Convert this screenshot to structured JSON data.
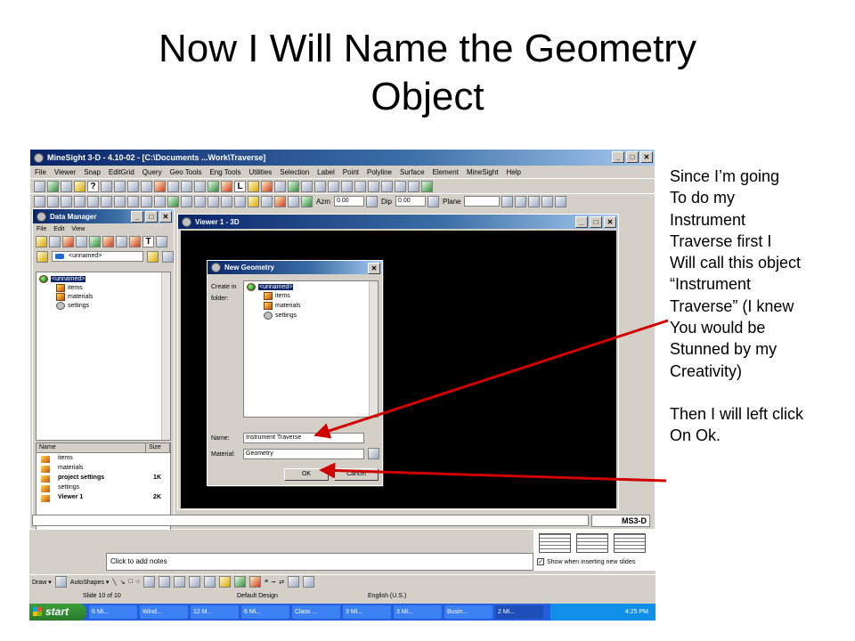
{
  "slide": {
    "title_line1": "Now I Will Name the Geometry",
    "title_line2": "Object",
    "notes": [
      "Since I’m going",
      "To do my",
      "Instrument",
      "Traverse first I",
      "Will call this object",
      "“Instrument",
      "Traverse” (I knew",
      "You would be",
      "Stunned by my",
      "Creativity)",
      "",
      "Then I will left click",
      "On Ok."
    ]
  },
  "minesight": {
    "title": "MineSight 3-D  - 4.10-02 - [C:\\Documents ...Work\\Traverse]",
    "menu": [
      "File",
      "Viewer",
      "Snap",
      "EditGrid",
      "Query",
      "Geo Tools",
      "Eng Tools",
      "Utilities",
      "Selection",
      "Label",
      "Point",
      "Polyline",
      "Surface",
      "Element",
      "MineSight",
      "Help"
    ],
    "azm_label": "Azm",
    "azm_value": "0.00",
    "dip_label": "Dip",
    "dip_value": "0.00",
    "plane_label": "Plane"
  },
  "data_manager": {
    "title": "Data Manager",
    "menu": [
      "File",
      "Edit",
      "View"
    ],
    "combo_value": "<unnamed>",
    "tree": [
      "<unnamed>",
      "items",
      "materials",
      "settings"
    ],
    "list_headers": [
      "Name",
      "Size"
    ],
    "list_rows": [
      {
        "name": "items",
        "size": ""
      },
      {
        "name": "materials",
        "size": ""
      },
      {
        "name": "project settings",
        "size": "1K"
      },
      {
        "name": "settings",
        "size": ""
      },
      {
        "name": "Viewer 1",
        "size": "2K"
      }
    ]
  },
  "viewer": {
    "title": "Viewer 1 - 3D"
  },
  "dialog": {
    "title": "New Geometry",
    "create_in_label": "Create in",
    "folder_label": "folder:",
    "tree": [
      "<unnamed>",
      "items",
      "materials",
      "settings"
    ],
    "name_label": "Name:",
    "name_value": "Instrument Traverse",
    "material_label": "Material:",
    "material_value": "Geometry",
    "ok_label": "OK",
    "cancel_label": "Cancel"
  },
  "powerpoint": {
    "notes_placeholder": "Click to add notes",
    "show_when_inserting": "Show when inserting new slides",
    "draw_label": "Draw ▾",
    "autoshapes_label": "AutoShapes ▾",
    "slide_count": "Slide 10 of 10",
    "design": "Default Design",
    "language": "English (U.S.)"
  },
  "taskbar": {
    "start": "start",
    "tasks": [
      "6 Mi...",
      "Wind...",
      "12 M...",
      "6 Mi...",
      "Class ...",
      "3 Mi...",
      "3 Mi...",
      "Busin...",
      "2 Mi..."
    ],
    "clock": "4:25 PM"
  },
  "minesight_logo": "MS3-D",
  "colors": {
    "arrow": "#d00000",
    "titlebar": "#0a246a",
    "taskbar": "#245edc"
  }
}
